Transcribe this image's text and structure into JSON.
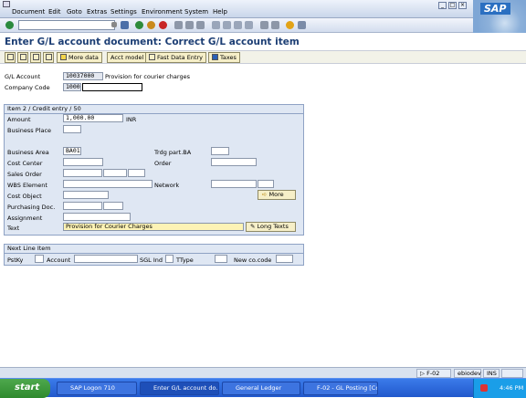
{
  "menu": [
    "Document",
    "Edit",
    "Goto",
    "Extras",
    "Settings",
    "Environment",
    "System",
    "Help"
  ],
  "brand": "SAP",
  "title": "Enter G/L account document: Correct G/L account item",
  "toolbar": {
    "more_data": "More data",
    "acct_model": "Acct model",
    "fast_data_entry": "Fast Data Entry",
    "taxes": "Taxes"
  },
  "header": {
    "gl_account_label": "G/L Account",
    "gl_account": "10037000",
    "gl_account_desc": "Provision for courier charges",
    "company_code_label": "Company Code",
    "company_code": "1000"
  },
  "item": {
    "group_title": "Item 2 / Credit entry / 50",
    "amount_label": "Amount",
    "amount": "1,000.00",
    "currency": "INR",
    "business_place_label": "Business Place",
    "business_area_label": "Business Area",
    "business_area": "BA01",
    "trdg_part_label": "Trdg part.BA",
    "cost_center_label": "Cost Center",
    "order_label": "Order",
    "sales_order_label": "Sales Order",
    "wbs_label": "WBS Element",
    "network_label": "Network",
    "cost_object_label": "Cost Object",
    "more_label": "More",
    "purchasing_doc_label": "Purchasing Doc.",
    "assignment_label": "Assignment",
    "text_label": "Text",
    "text": "Provision for Courier Charges",
    "long_texts_label": "Long Texts"
  },
  "next_line": {
    "group_title": "Next Line Item",
    "pstky_label": "PstKy",
    "account_label": "Account",
    "sgl_label": "SGL Ind",
    "ttype_label": "TType",
    "new_co_code_label": "New co.code"
  },
  "status_bar": {
    "tcode": "F-02",
    "server": "ebiodev",
    "mode": "INS"
  },
  "taskbar": {
    "start": "start",
    "tasks": [
      "SAP Logon 710",
      "Enter G/L account do...",
      "General Ledger",
      "F-02 - GL Posting [Co..."
    ],
    "clock": "4:46 PM"
  },
  "colors": {
    "title": "#1c3e74",
    "group_bg": "#dfe7f3",
    "button_bg": "#f6efc8",
    "text_field_bg": "#fdf3b5",
    "taskbar": "#2158cc"
  }
}
